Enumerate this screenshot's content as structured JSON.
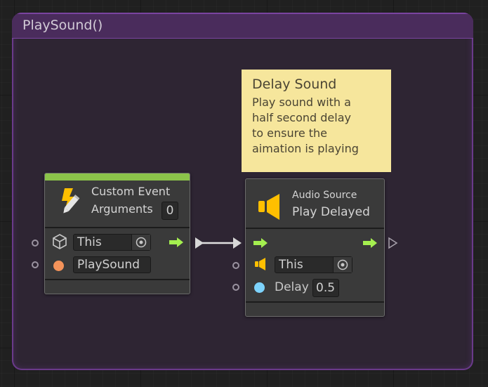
{
  "group": {
    "title": "PlaySound()",
    "accent": "#6a3a8a"
  },
  "note": {
    "title": "Delay Sound",
    "body": "Play sound with a\nhalf second delay\nto ensure the\naimation is playing",
    "color": "#f6e69c"
  },
  "custom_event_node": {
    "icon": "event-lightning-pencil-icon",
    "title": "Custom Event",
    "arguments_label": "Arguments",
    "arguments_count": "0",
    "header_color": "#8bc34a",
    "target_icon": "gameobject-cube-icon",
    "target_value": "This",
    "event_name_value": "PlaySound",
    "event_name_port_color": "#f4935a",
    "control_output_icon": "arrow-right-icon"
  },
  "audio_node": {
    "icon": "speaker-icon",
    "subtitle": "Audio Source",
    "title": "Play Delayed",
    "target_icon": "speaker-icon",
    "target_value": "This",
    "delay_label": "Delay",
    "delay_value": "0.5",
    "delay_port_color": "#7dd3fc",
    "control_input_icon": "arrow-right-icon",
    "control_output_icon": "arrow-right-icon"
  },
  "colors": {
    "control_arrow": "#a4ef4f",
    "speaker": "#ffbf00"
  }
}
